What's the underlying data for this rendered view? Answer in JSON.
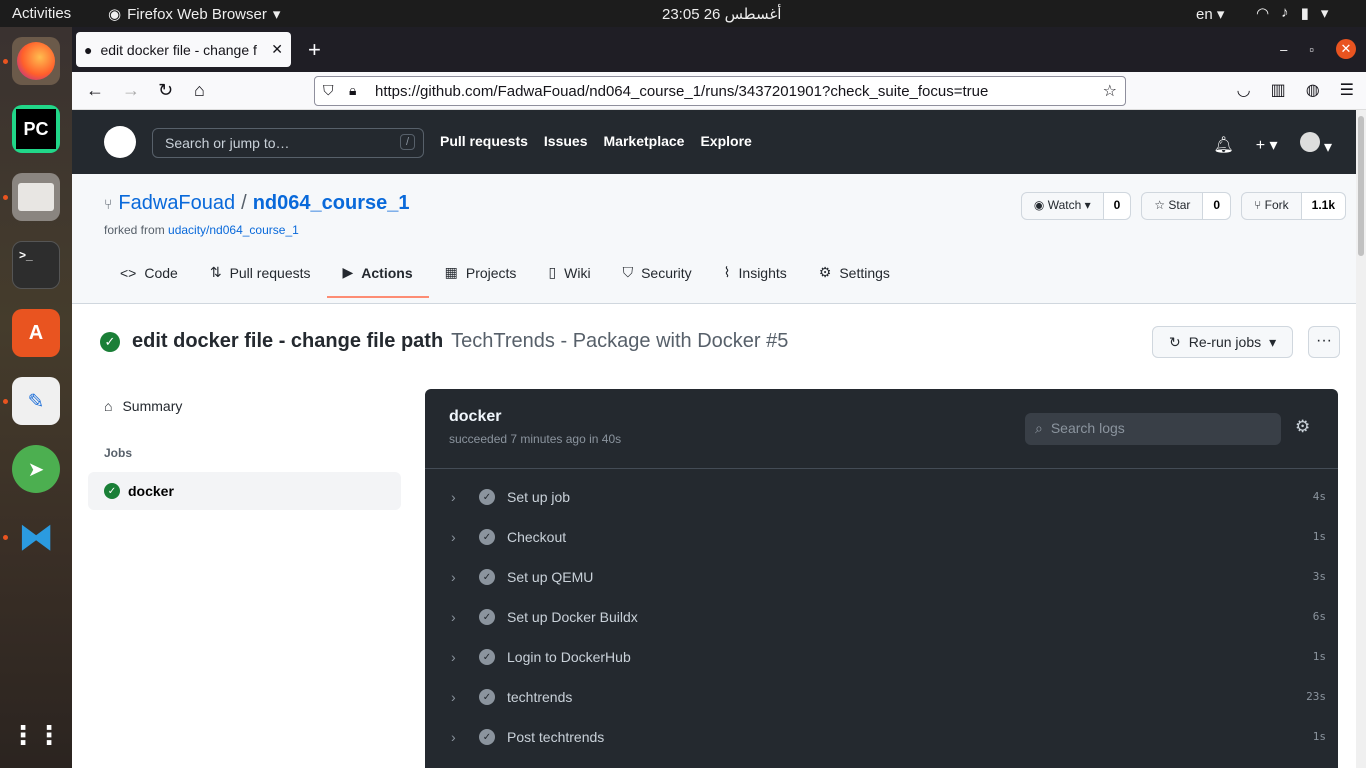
{
  "topbar": {
    "activities": "Activities",
    "app": "Firefox Web Browser",
    "clock": "23:05  26 أغسطس",
    "lang": "en"
  },
  "dock": {
    "items": [
      "firefox-icon",
      "pycharm-icon",
      "files-icon",
      "terminal-icon",
      "software-center-icon",
      "text-editor-icon",
      "send-icon",
      "vscode-icon",
      "app-grid-icon"
    ]
  },
  "browser": {
    "tab_title": "edit docker file - change f",
    "url": "https://github.com/FadwaFouad/nd064_course_1/runs/3437201901?check_suite_focus=true"
  },
  "github": {
    "search_placeholder": "Search or jump to…",
    "search_key": "/",
    "nav": [
      "Pull requests",
      "Issues",
      "Marketplace",
      "Explore"
    ],
    "repo": {
      "owner": "FadwaFouad",
      "sep": "/",
      "name": "nd064_course_1",
      "forked_prefix": "forked from ",
      "forked_link": "udacity/nd064_course_1",
      "watch_label": "Watch",
      "watch_count": "0",
      "star_label": "Star",
      "star_count": "0",
      "fork_label": "Fork",
      "fork_count": "1.1k"
    },
    "tabs": [
      "Code",
      "Pull requests",
      "Actions",
      "Projects",
      "Wiki",
      "Security",
      "Insights",
      "Settings"
    ],
    "run": {
      "title": "edit docker file - change file path",
      "workflow": "TechTrends - Package with Docker #5",
      "rerun": "Re-run jobs",
      "more": "···"
    },
    "sidebar": {
      "summary": "Summary",
      "jobs_heading": "Jobs",
      "job": "docker"
    },
    "log": {
      "job_name": "docker",
      "status": "succeeded 7 minutes ago in 40s",
      "search_placeholder": "Search logs",
      "steps": [
        {
          "name": "Set up job",
          "dur": "4s"
        },
        {
          "name": "Checkout",
          "dur": "1s"
        },
        {
          "name": "Set up QEMU",
          "dur": "3s"
        },
        {
          "name": "Set up Docker Buildx",
          "dur": "6s"
        },
        {
          "name": "Login to DockerHub",
          "dur": "1s"
        },
        {
          "name": "techtrends",
          "dur": "23s"
        },
        {
          "name": "Post techtrends",
          "dur": "1s"
        }
      ]
    }
  }
}
